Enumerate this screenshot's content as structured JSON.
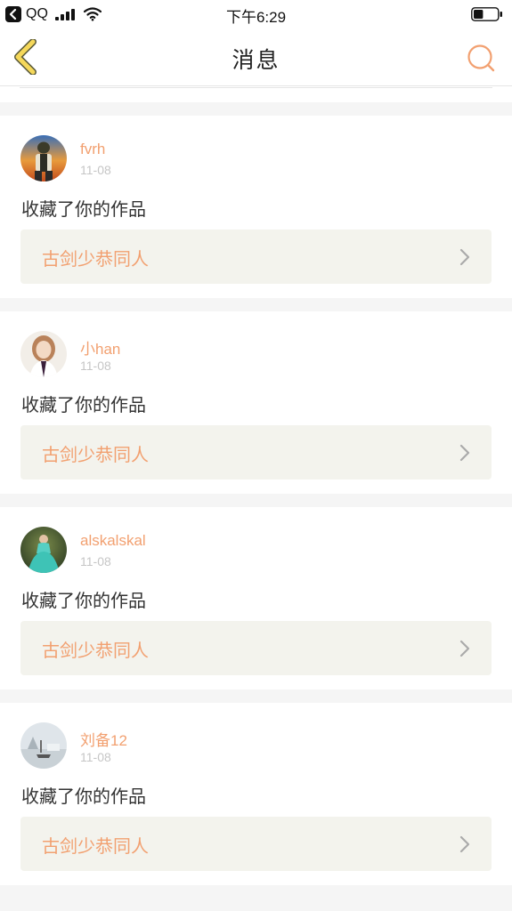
{
  "status_bar": {
    "app": "QQ",
    "time": "下午6:29",
    "battery_level": 0.4,
    "icons": [
      "back-to-app-icon",
      "signal-icon",
      "wifi-icon",
      "battery-icon"
    ]
  },
  "nav": {
    "title": "消息",
    "icons": [
      "back-chevron-icon",
      "search-icon"
    ]
  },
  "colors": {
    "accent": "#f2a070",
    "back_chevron_fill": "#f5d85a",
    "back_chevron_stroke": "#5a5a3a",
    "work_box_bg": "#f3f3ed",
    "page_bg": "#f5f5f5",
    "time_text": "#c6c6c6"
  },
  "messages": [
    {
      "user": "fvrh",
      "time": "11-08",
      "action": "收藏了你的作品",
      "work": "古剑少恭同人",
      "avatar": "avatar-game-character"
    },
    {
      "user": "小han",
      "time": "11-08",
      "action": "收藏了你的作品",
      "work": "古剑少恭同人",
      "avatar": "avatar-girl-portrait"
    },
    {
      "user": "alskalskal",
      "time": "11-08",
      "action": "收藏了你的作品",
      "work": "古剑少恭同人",
      "avatar": "avatar-dress-portrait"
    },
    {
      "user": "刘备12",
      "time": "11-08",
      "action": "收藏了你的作品",
      "work": "古剑少恭同人",
      "avatar": "avatar-landscape"
    }
  ]
}
